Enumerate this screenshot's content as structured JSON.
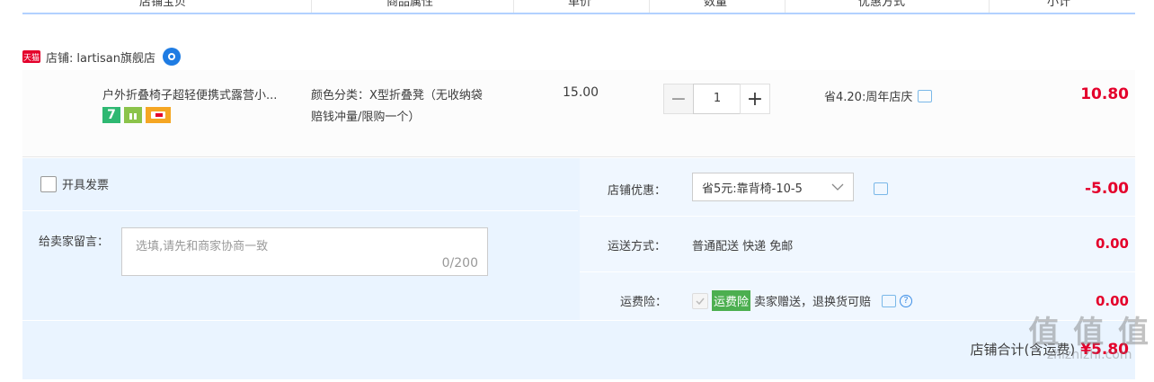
{
  "table_header": {
    "columns": [
      "店铺宝贝",
      "商品属性",
      "单价",
      "数量",
      "优惠方式",
      "小计"
    ]
  },
  "shop": {
    "badge": "天猫",
    "label": "店铺:",
    "name": "lartisan旗舰店"
  },
  "item": {
    "title": "户外折叠椅子超轻便携式露营小...",
    "attribute": "颜色分类：X型折叠凳（无收纳袋赔钱冲量/限购一个）",
    "attribute_line1": "颜色分类：X型折叠凳（无收纳袋",
    "attribute_line2": "赔钱冲量/限购一个）",
    "price": "15.00",
    "quantity": "1",
    "decrement": "−",
    "increment": "+",
    "promo": "省4.20:周年店庆",
    "subtotal": "10.80",
    "badge_seven": "7"
  },
  "invoice": {
    "label": "开具发票"
  },
  "message": {
    "label": "给卖家留言：",
    "placeholder": "选填,请先和商家协商一致",
    "counter": "0/200"
  },
  "shop_discount": {
    "label": "店铺优惠：",
    "selected": "省5元:靠背椅-10-5",
    "amount": "-5.00"
  },
  "shipping": {
    "label": "运送方式：",
    "value": "普通配送 快递 免邮",
    "amount": "0.00"
  },
  "insurance": {
    "label": "运费险：",
    "badge": "运费险",
    "text": "卖家赠送，退换货可赔",
    "help": "?",
    "amount": "0.00"
  },
  "total": {
    "label": "店铺合计(含运费)",
    "amount": "¥5.80"
  },
  "watermark": {
    "text": "值 值 值",
    "url": "zhizhizhi.com"
  },
  "colors": {
    "accent_red": "#e4002b",
    "header_line": "#b2d1ff",
    "footer_bg": "#eaf4ff",
    "insurance_green": "#4caf50"
  }
}
